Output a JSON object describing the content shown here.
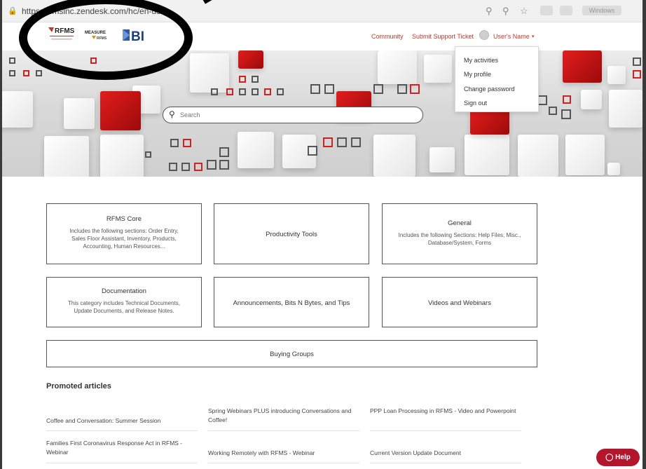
{
  "browser": {
    "url": "https://rfmsinc.zendesk.com/hc/en-us",
    "profile_text": "Windows"
  },
  "header": {
    "logos": [
      "RFMS",
      "MEASURE by RFMS",
      "BI"
    ],
    "nav": {
      "community": "Community",
      "submit_ticket": "Submit Support Ticket",
      "user_name": "User's Name"
    }
  },
  "user_menu": {
    "items": [
      "My activities",
      "My profile",
      "Change password",
      "Sign out"
    ]
  },
  "search": {
    "placeholder": "Search"
  },
  "categories": [
    {
      "title": "RFMS Core",
      "description": "Includes the following sections: Order Entry, Sales Floor Assistant, Inventory, Products, Accounting, Human Resources..."
    },
    {
      "title": "Productivity Tools",
      "description": ""
    },
    {
      "title": "General",
      "description": "Includes the following Sections: Help Files, Misc., Database/System, Forms"
    },
    {
      "title": "Documentation",
      "description": "This category includes Technical Documents, Update Documents, and Release Notes."
    },
    {
      "title": "Announcements, Bits N Bytes, and Tips",
      "description": ""
    },
    {
      "title": "Videos and Webinars",
      "description": ""
    },
    {
      "title": "Buying Groups",
      "description": ""
    }
  ],
  "promoted": {
    "heading": "Promoted articles",
    "articles": [
      "Coffee and Conversation: Summer Session",
      "Spring Webinars PLUS introducing Conversations and Coffee!",
      "PPP Loan Processing in RFMS - Video and Powerpoint",
      "Families First Coronavirus Response Act in RFMS - Webinar",
      "Working Remotely with RFMS - Webinar",
      "Current Version Update Document"
    ]
  },
  "help_button": "Help",
  "colors": {
    "accent": "#c0392b",
    "help_bg": "#b3162c",
    "hero_red": "#d21a1a"
  }
}
